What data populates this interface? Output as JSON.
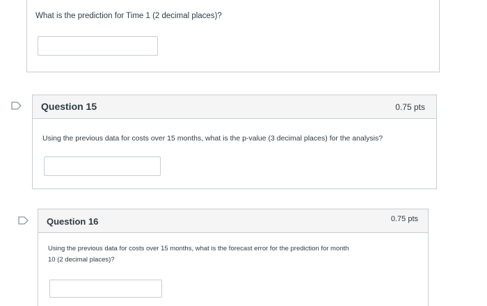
{
  "question_14": {
    "text": "What is the prediction for Time 1 (2 decimal places)?",
    "answer_value": ""
  },
  "question_15": {
    "title": "Question 15",
    "points": "0.75 pts",
    "text": "Using the previous data for costs over 15 months, what is the p-value (3 decimal places) for the analysis?",
    "answer_value": ""
  },
  "question_16": {
    "title": "Question 16",
    "points": "0.75 pts",
    "text_line1": "Using the previous data for costs over 15 months, what is the forecast error for the prediction for month",
    "text_line2": "10 (2 decimal places)?",
    "answer_value": ""
  },
  "icons": {
    "flag_icon": "flag-icon"
  },
  "colors": {
    "border": "#c7cdd1",
    "header_bg": "#f5f5f5",
    "text": "#2d3b45"
  }
}
